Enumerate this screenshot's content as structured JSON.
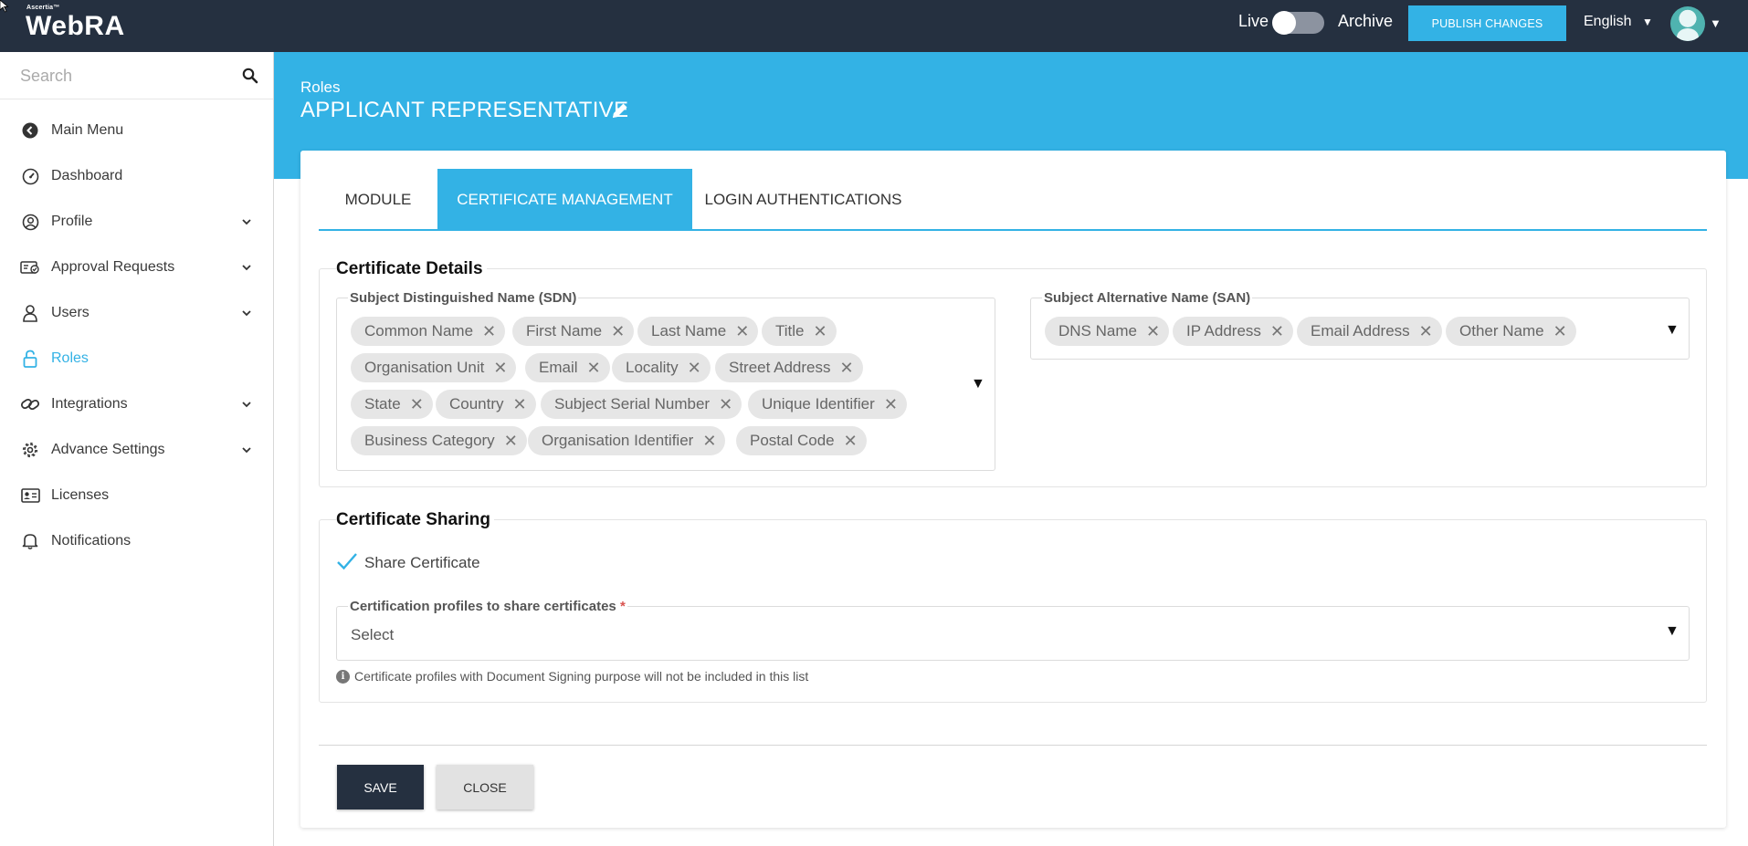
{
  "topbar": {
    "brand_small": "Ascertia™",
    "brand": "WebRA",
    "live_label": "Live",
    "archive_label": "Archive",
    "publish_label": "PUBLISH CHANGES",
    "language": "English"
  },
  "sidebar": {
    "search_placeholder": "Search",
    "items": [
      {
        "label": "Main Menu",
        "icon": "back-circle-icon",
        "expandable": false
      },
      {
        "label": "Dashboard",
        "icon": "dashboard-gauge-icon",
        "expandable": false
      },
      {
        "label": "Profile",
        "icon": "user-circle-icon",
        "expandable": true
      },
      {
        "label": "Approval Requests",
        "icon": "approval-card-icon",
        "expandable": true
      },
      {
        "label": "Users",
        "icon": "users-icon",
        "expandable": true
      },
      {
        "label": "Roles",
        "icon": "lock-icon",
        "expandable": false,
        "active": true
      },
      {
        "label": "Integrations",
        "icon": "link-icon",
        "expandable": true
      },
      {
        "label": "Advance Settings",
        "icon": "gear-icon",
        "expandable": true
      },
      {
        "label": "Licenses",
        "icon": "id-card-icon",
        "expandable": false
      },
      {
        "label": "Notifications",
        "icon": "bell-icon",
        "expandable": false
      }
    ]
  },
  "header": {
    "breadcrumb": "Roles",
    "title": "APPLICANT REPRESENTATIVE"
  },
  "tabs": [
    "MODULE",
    "CERTIFICATE MANAGEMENT",
    "LOGIN AUTHENTICATIONS"
  ],
  "certificate_details": {
    "legend": "Certificate Details",
    "sdn": {
      "label": "Subject Distinguished Name (SDN)",
      "chips": [
        "Common Name",
        "First Name",
        "Last Name",
        "Title",
        "Organisation Unit",
        "Email",
        "Locality",
        "Street Address",
        "State",
        "Country",
        "Subject Serial Number",
        "Unique Identifier",
        "Business Category",
        "Organisation Identifier",
        "Postal Code"
      ]
    },
    "san": {
      "label": "Subject Alternative Name (SAN)",
      "chips": [
        "DNS Name",
        "IP Address",
        "Email Address",
        "Other Name"
      ]
    }
  },
  "certificate_sharing": {
    "legend": "Certificate Sharing",
    "share_label": "Share Certificate",
    "share_checked": true,
    "profiles_label": "Certification profiles to share certificates",
    "required_mark": "*",
    "select_value": "Select",
    "info_text": "Certificate profiles with Document Signing purpose will not be included in this list"
  },
  "actions": {
    "save_label": "SAVE",
    "close_label": "CLOSE"
  },
  "colors": {
    "topbar": "#253040",
    "accent": "#33b2e5"
  }
}
